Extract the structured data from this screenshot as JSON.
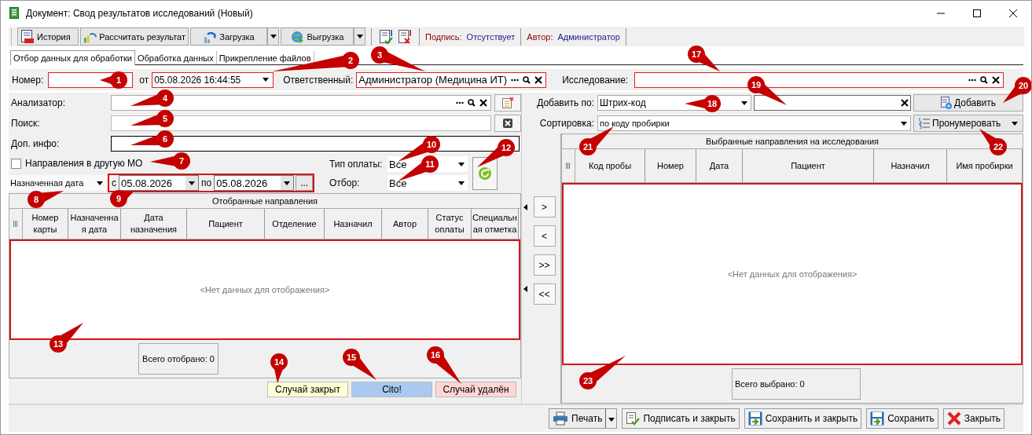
{
  "window": {
    "title": "Документ: Свод результатов исследований (Новый)"
  },
  "toolbar": {
    "buttons": [
      {
        "label": "История",
        "kind": "history",
        "menu": false
      },
      {
        "label": "Рассчитать результат",
        "kind": "calculate",
        "menu": false
      },
      {
        "label": "Загрузка",
        "kind": "import",
        "menu": true
      },
      {
        "label": "Выгрузка",
        "kind": "export",
        "menu": true
      }
    ],
    "signature_label": "Подпись:",
    "signature_value": "Отсутствует",
    "author_label": "Автор:",
    "author_value": "Администратор"
  },
  "tabs": [
    {
      "label": "Отбор данных для обработки",
      "selected": true
    },
    {
      "label": "Обработка данных",
      "selected": false
    },
    {
      "label": "Прикрепление файлов",
      "selected": false
    }
  ],
  "header": {
    "number_label": "Номер:",
    "date_label": "от",
    "date_value": "05.08.2026 16:44:55",
    "responsible_label": "Ответственный:",
    "responsible_value": "Администратор (Медицина ИТ)",
    "study_label": "Исследование:"
  },
  "filters": {
    "analyzer_label": "Анализатор:",
    "search_label": "Поиск:",
    "extra_label": "Доп. инфо:",
    "other_mo": {
      "label": "Направления в другую МО",
      "checked": false
    },
    "date_kind": "Назначенная дата",
    "from_label": "с",
    "from_value": "05.08.2026",
    "to_label": "по",
    "to_value": "05.08.2026",
    "more_button": "...",
    "payment_label": "Тип оплаты:",
    "payment_value": "Все",
    "selection_label": "Отбор:",
    "selection_value": "Все"
  },
  "selected_grid": {
    "title": "Отобранные направления",
    "columns": [
      "Номер карты",
      "Назначенная дата",
      "Дата назначения",
      "Пациент",
      "Отделение",
      "Назначил",
      "Автор",
      "Статус оплаты",
      "Специальная отметка"
    ],
    "empty_text": "<Нет данных для отображения>",
    "total": "Всего отобрано: 0"
  },
  "legend": [
    {
      "label": "Случай закрыт",
      "color": "#ffffd6"
    },
    {
      "label": "Cito!",
      "color": "#a9c9f0"
    },
    {
      "label": "Случай удалён",
      "color": "#ffd6d6"
    }
  ],
  "transfer_buttons": [
    ">",
    "<",
    ">>",
    "<<"
  ],
  "right": {
    "add_by_label": "Добавить по:",
    "add_by_value": "Штрих-код",
    "sort_label": "Сортировка:",
    "sort_value": "по коду пробирки",
    "add_button": "Добавить",
    "number_button": "Пронумеровать"
  },
  "chosen_grid": {
    "title": "Выбранные направления на исследования",
    "columns": [
      "Код пробы",
      "Номер",
      "Дата",
      "Пациент",
      "Назначил",
      "Имя пробирки"
    ],
    "empty_text": "<Нет данных для отображения>",
    "total": "Всего выбрано: 0"
  },
  "footer_buttons": [
    {
      "label": "Печать",
      "kind": "print",
      "menu": true
    },
    {
      "label": "Подписать и закрыть",
      "kind": "sign",
      "menu": false
    },
    {
      "label": "Сохранить и закрыть",
      "kind": "save",
      "menu": false
    },
    {
      "label": "Сохранить",
      "kind": "save",
      "menu": false
    },
    {
      "label": "Закрыть",
      "kind": "close",
      "menu": false
    }
  ],
  "callouts": [
    {
      "number": "1"
    },
    {
      "number": "2"
    },
    {
      "number": "3"
    },
    {
      "number": "4"
    },
    {
      "number": "5"
    },
    {
      "number": "6"
    },
    {
      "number": "7"
    },
    {
      "number": "8"
    },
    {
      "number": "9"
    },
    {
      "number": "10"
    },
    {
      "number": "11"
    },
    {
      "number": "12"
    },
    {
      "number": "13"
    },
    {
      "number": "14"
    },
    {
      "number": "15"
    },
    {
      "number": "16"
    },
    {
      "number": "17"
    },
    {
      "number": "18"
    },
    {
      "number": "19"
    },
    {
      "number": "20"
    },
    {
      "number": "21"
    },
    {
      "number": "22"
    },
    {
      "number": "23"
    }
  ]
}
